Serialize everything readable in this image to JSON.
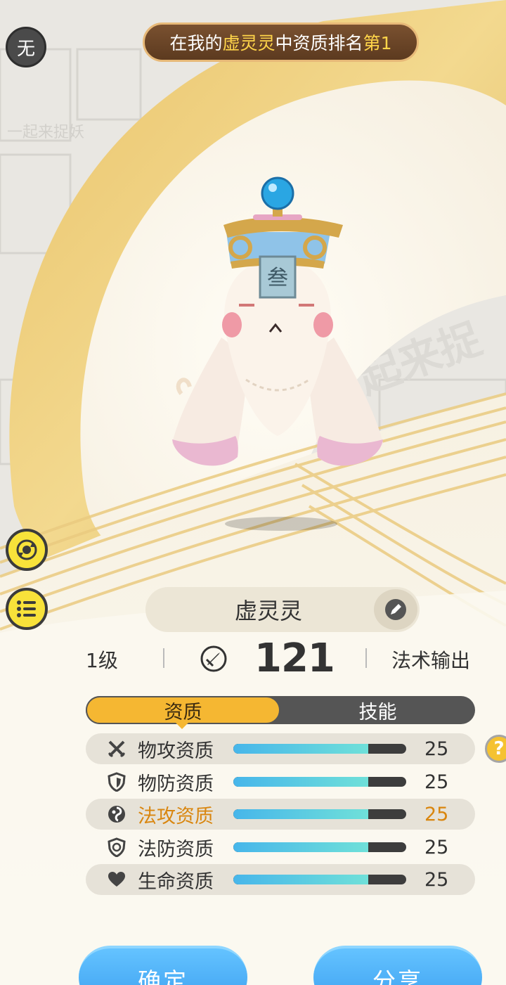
{
  "header": {
    "element_badge": "无",
    "rank_prefix": "在我的",
    "rank_pet": "虚灵灵",
    "rank_middle": "中资质排名",
    "rank_value": "第1"
  },
  "pet": {
    "name": "虚灵灵",
    "talisman_char": "叁",
    "level": "1级",
    "power": "121",
    "role": "法术输出"
  },
  "tabs": {
    "active": "资质",
    "inactive": "技能"
  },
  "stats": [
    {
      "label": "物攻资质",
      "value": "25",
      "fill": 0.78,
      "icon": "crossed-swords-icon"
    },
    {
      "label": "物防资质",
      "value": "25",
      "fill": 0.78,
      "icon": "shield-icon"
    },
    {
      "label": "法攻资质",
      "value": "25",
      "fill": 0.78,
      "icon": "magic-swirl-icon"
    },
    {
      "label": "法防资质",
      "value": "25",
      "fill": 0.78,
      "icon": "magic-shield-icon"
    },
    {
      "label": "生命资质",
      "value": "25",
      "fill": 0.78,
      "icon": "heart-icon"
    }
  ],
  "help_glyph": "?",
  "buttons": {
    "confirm": "确定",
    "share": "分享"
  },
  "background_watermark": "一起来捉妖",
  "colors": {
    "accent_gold": "#f5b732",
    "highlight_orange": "#d9860f",
    "button_blue": "#3b9ff0",
    "bar_fill": "#5fcde3"
  }
}
